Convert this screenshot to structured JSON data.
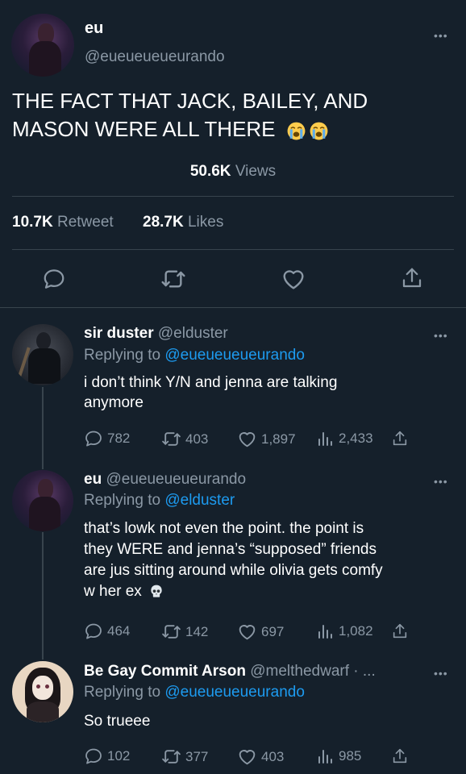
{
  "main_tweet": {
    "name": "eu",
    "handle": "@eueueueueurando",
    "text": "THE FACT THAT JACK, BAILEY, AND MASON WERE ALL THERE",
    "text_line1": "THE FACT THAT JACK, BAILEY, AND",
    "text_line2": "MASON WERE ALL THERE",
    "emoji": "loudly-crying-face x2",
    "views_count": "50.6K",
    "views_label": "Views",
    "retweets_count": "10.7K",
    "retweets_label": "Retweet",
    "likes_count": "28.7K",
    "likes_label": "Likes"
  },
  "replies": [
    {
      "name": "sir duster",
      "handle": "@elduster",
      "replying_prefix": "Replying to",
      "replying_to": "@eueueueueurando",
      "line1": "i don’t think Y/N and jenna are talking",
      "line2": "anymore",
      "replies": "782",
      "retweets": "403",
      "likes": "1,897",
      "views": "2,433"
    },
    {
      "name": "eu",
      "handle": "@eueueueueurando",
      "replying_prefix": "Replying to",
      "replying_to": "@elduster",
      "line1": "that’s lowk not even the point. the point is",
      "line2": "they WERE and jenna’s “supposed” friends",
      "line3": "are jus sitting around while olivia gets comfy",
      "line4": "w her ex",
      "emoji": "skull",
      "replies": "464",
      "retweets": "142",
      "likes": "697",
      "views": "1,082"
    },
    {
      "name": "Be Gay Commit Arson",
      "handle": "@melthedwarf · ...",
      "replying_prefix": "Replying to",
      "replying_to": "@eueueueueurando",
      "line1": "So trueee",
      "replies": "102",
      "retweets": "377",
      "likes": "403",
      "views": "985"
    }
  ],
  "icons": {
    "more": "more-horizontal-icon",
    "reply": "reply-icon",
    "retweet": "retweet-icon",
    "like": "heart-icon",
    "views": "views-bar-chart-icon",
    "share": "share-icon"
  },
  "colors": {
    "background": "#15202b",
    "text": "#ffffff",
    "muted": "#8b98a5",
    "link": "#1d9bf0",
    "divider": "#38444d"
  }
}
